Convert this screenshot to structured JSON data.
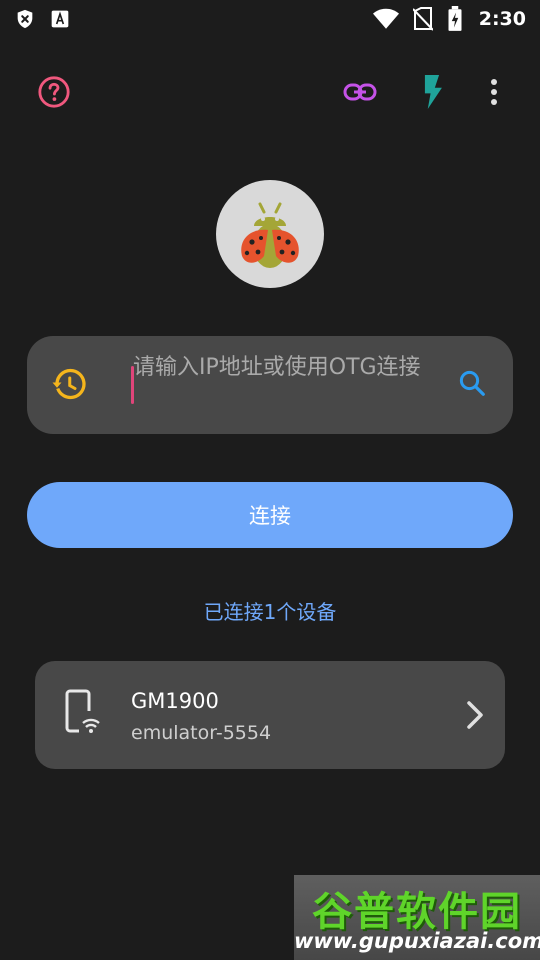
{
  "status_bar": {
    "time": "2:30",
    "icons": [
      "shield-x-icon",
      "font-a-icon",
      "wifi-icon",
      "no-sim-icon",
      "battery-charging-icon"
    ]
  },
  "toolbar": {
    "help_icon": "help-circle-icon",
    "link_icon": "link-icon",
    "flash_icon": "flash-icon",
    "more_icon": "more-vert-icon"
  },
  "colors": {
    "background": "#1c1c1c",
    "card": "#484848",
    "accent_blue": "#6fa8fa",
    "help_pink": "#f0587e",
    "link_purple": "#c552e8",
    "flash_teal": "#1fa39a",
    "history_yellow": "#f5b51c",
    "search_blue": "#2a9bf0"
  },
  "input": {
    "placeholder": "请输入IP地址或使用OTG连接"
  },
  "connect_button": {
    "label": "连接"
  },
  "connected_status": "已连接1个设备",
  "devices": [
    {
      "name": "GM1900",
      "serial": "emulator-5554"
    }
  ],
  "watermark": {
    "title": "谷普软件园",
    "url": "www.gupuxiazai.com"
  }
}
